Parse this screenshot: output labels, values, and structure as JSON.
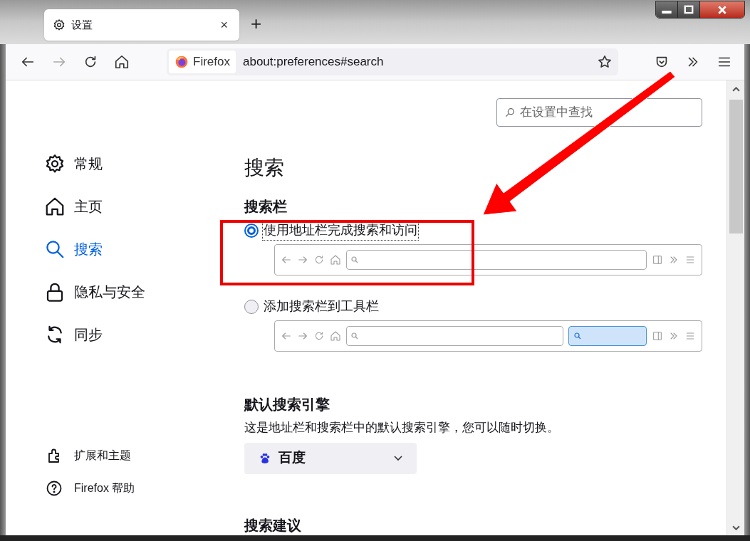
{
  "tab": {
    "title": "设置",
    "close": "×"
  },
  "new_tab": "+",
  "url_bar": {
    "identity": "Firefox",
    "url": "about:preferences#search"
  },
  "search_field": {
    "placeholder": "在设置中查找"
  },
  "sidebar": {
    "items": [
      {
        "label": "常规",
        "kind": "gear",
        "selected": false
      },
      {
        "label": "主页",
        "kind": "home",
        "selected": false
      },
      {
        "label": "搜索",
        "kind": "search",
        "selected": true
      },
      {
        "label": "隐私与安全",
        "kind": "lock",
        "selected": false
      },
      {
        "label": "同步",
        "kind": "sync",
        "selected": false
      }
    ],
    "footer": [
      {
        "label": "扩展和主题",
        "kind": "puzzle"
      },
      {
        "label": "Firefox 帮助",
        "kind": "help"
      }
    ]
  },
  "page_title": "搜索",
  "search_bar_section": {
    "heading": "搜索栏",
    "options": [
      {
        "label": "使用地址栏完成搜索和访问",
        "selected": true,
        "separate_search_box": false
      },
      {
        "label": "添加搜索栏到工具栏",
        "selected": false,
        "separate_search_box": true
      }
    ]
  },
  "default_engine": {
    "heading": "默认搜索引擎",
    "description": "这是地址栏和搜索栏中的默认搜索引擎，您可以随时切换。",
    "engine": "百度"
  },
  "next_heading": "搜索建议"
}
